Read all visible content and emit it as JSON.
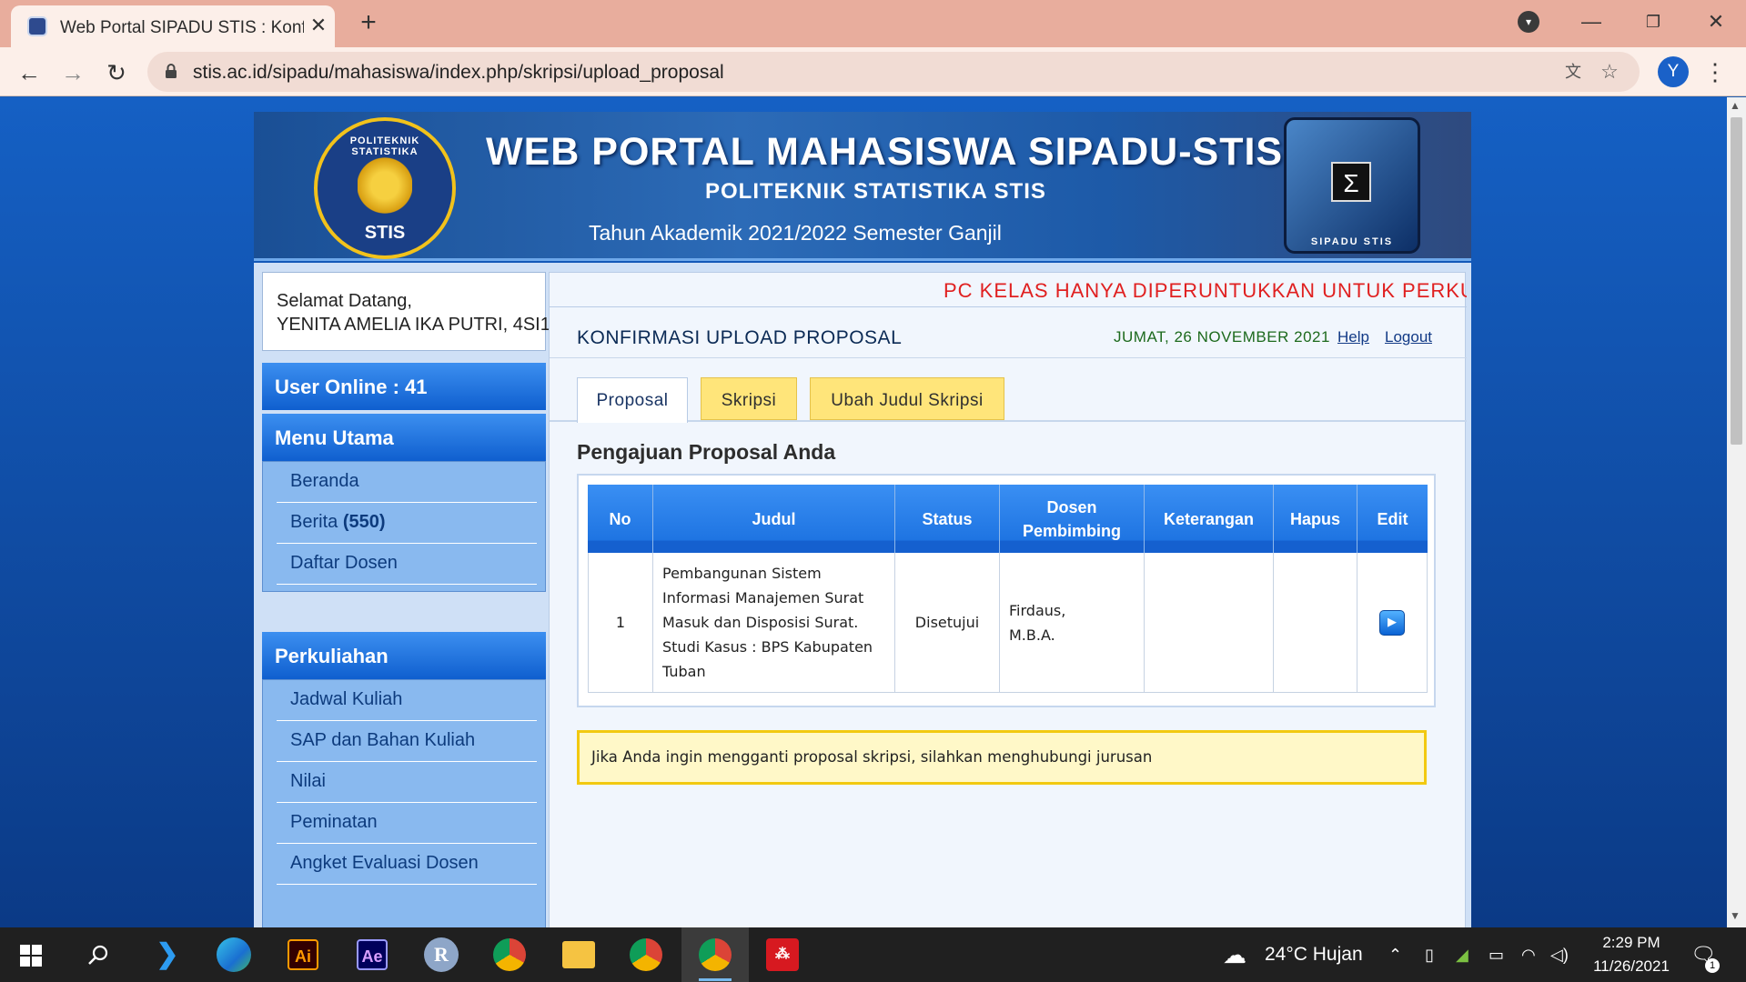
{
  "browser": {
    "tab_title": "Web Portal SIPADU STIS : Konfirm",
    "new_tab": "+",
    "url": "stis.ac.id/sipadu/mahasiswa/index.php/skripsi/upload_proposal",
    "profile_initial": "Y",
    "icons": [
      "back-arrow-icon",
      "forward-arrow-icon",
      "reload-icon",
      "lock-icon",
      "translate-icon",
      "star-icon",
      "menu-dots-icon",
      "minimize-icon",
      "restore-icon",
      "close-icon"
    ]
  },
  "banner": {
    "title": "WEB PORTAL MAHASISWA SIPADU-STIS",
    "subtitle": "POLITEKNIK STATISTIKA STIS",
    "academic_year": "Tahun Akademik 2021/2022 Semester Ganjil",
    "logo_ring": "POLITEKNIK STATISTIKA",
    "logo_text": "STIS",
    "box_logo_label": "SIPADU STIS",
    "box_logo_symbol": "Σ"
  },
  "sidebar": {
    "welcome": "Selamat Datang,",
    "user": "YENITA AMELIA IKA PUTRI, 4SI1",
    "online": "User Online : 41",
    "menu_utama": {
      "header": "Menu Utama",
      "items": [
        {
          "label": "Beranda"
        },
        {
          "label": "Berita",
          "count": "(550)"
        },
        {
          "label": "Daftar Dosen"
        }
      ]
    },
    "perkuliahan": {
      "header": "Perkuliahan",
      "items": [
        {
          "label": "Jadwal Kuliah"
        },
        {
          "label": "SAP dan Bahan Kuliah"
        },
        {
          "label": "Nilai"
        },
        {
          "label": "Peminatan"
        },
        {
          "label": "Angket Evaluasi Dosen"
        }
      ]
    }
  },
  "content": {
    "ticker": "PC KELAS HANYA DIPERUNTUKKAN UNTUK PERKUL",
    "page_title": "KONFIRMASI UPLOAD PROPOSAL",
    "date": "JUMAT, 26 NOVEMBER 2021",
    "help": "Help",
    "logout": "Logout",
    "tabs": [
      "Proposal",
      "Skripsi",
      "Ubah Judul Skripsi"
    ],
    "section_title": "Pengajuan Proposal Anda",
    "table": {
      "headers": [
        "No",
        "Judul",
        "Status",
        "Dosen Pembimbing",
        "Keterangan",
        "Hapus",
        "Edit"
      ],
      "rows": [
        {
          "no": "1",
          "judul": "Pembangunan Sistem Informasi Manajemen Surat Masuk dan Disposisi Surat. Studi Kasus : BPS Kabupaten Tuban",
          "status": "Disetujui",
          "dosen": "Firdaus, M.B.A.",
          "keterangan": "",
          "hapus": ""
        }
      ]
    },
    "notice": "Jika Anda ingin mengganti proposal skripsi, silahkan menghubungi jurusan"
  },
  "taskbar": {
    "apps": [
      {
        "name": "windows-start-icon"
      },
      {
        "name": "search-icon"
      },
      {
        "name": "vscode-icon"
      },
      {
        "name": "edge-icon"
      },
      {
        "name": "illustrator-icon",
        "label": "Ai"
      },
      {
        "name": "after-effects-icon",
        "label": "Ae"
      },
      {
        "name": "r-icon",
        "label": "R"
      },
      {
        "name": "chrome-icon"
      },
      {
        "name": "file-explorer-icon"
      },
      {
        "name": "chrome-profile-icon"
      },
      {
        "name": "chrome-profile-y-icon"
      },
      {
        "name": "mendeley-icon"
      }
    ],
    "weather": "24°C  Hujan",
    "time": "2:29 PM",
    "date": "11/26/2021",
    "notifications": "1"
  },
  "colors": {
    "tab_bar": "#e8ad9d",
    "toolbar": "#fcefe9",
    "sidebar_header": "#1565d8",
    "ticker_text": "#e02020",
    "tab_inactive": "#ffe57a",
    "notice_border": "#f2c910"
  }
}
